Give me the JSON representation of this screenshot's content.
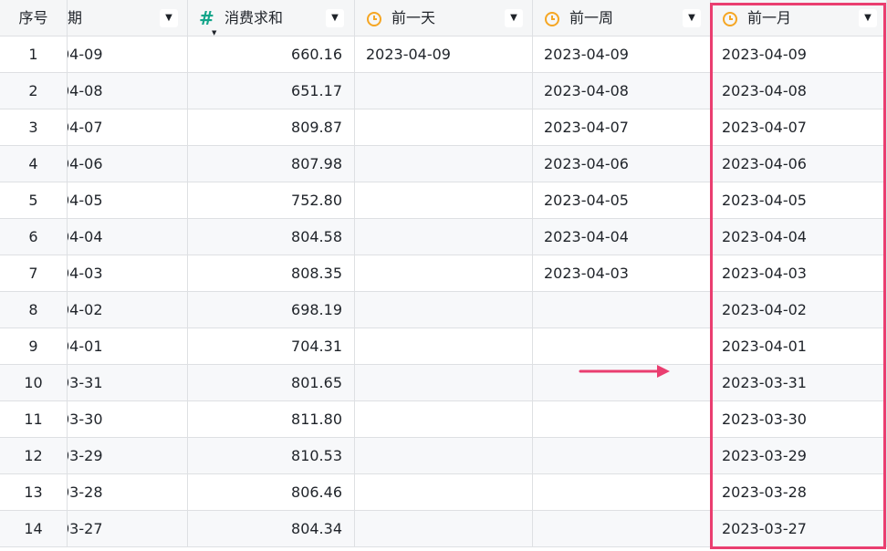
{
  "columns": {
    "index": {
      "label": "序号"
    },
    "date": {
      "label": "期"
    },
    "sum": {
      "label": "消费求和",
      "icon": "number-icon"
    },
    "prev_day": {
      "label": "前一天",
      "icon": "clock-icon"
    },
    "prev_week": {
      "label": "前一周",
      "icon": "clock-icon"
    },
    "prev_month": {
      "label": "前一月",
      "icon": "clock-icon"
    }
  },
  "rows": [
    {
      "idx": "1",
      "date": "04-09",
      "sum": "660.16",
      "prev_day": "2023-04-09",
      "prev_week": "2023-04-09",
      "prev_month": "2023-04-09"
    },
    {
      "idx": "2",
      "date": "04-08",
      "sum": "651.17",
      "prev_day": "",
      "prev_week": "2023-04-08",
      "prev_month": "2023-04-08"
    },
    {
      "idx": "3",
      "date": "04-07",
      "sum": "809.87",
      "prev_day": "",
      "prev_week": "2023-04-07",
      "prev_month": "2023-04-07"
    },
    {
      "idx": "4",
      "date": "04-06",
      "sum": "807.98",
      "prev_day": "",
      "prev_week": "2023-04-06",
      "prev_month": "2023-04-06"
    },
    {
      "idx": "5",
      "date": "04-05",
      "sum": "752.80",
      "prev_day": "",
      "prev_week": "2023-04-05",
      "prev_month": "2023-04-05"
    },
    {
      "idx": "6",
      "date": "04-04",
      "sum": "804.58",
      "prev_day": "",
      "prev_week": "2023-04-04",
      "prev_month": "2023-04-04"
    },
    {
      "idx": "7",
      "date": "04-03",
      "sum": "808.35",
      "prev_day": "",
      "prev_week": "2023-04-03",
      "prev_month": "2023-04-03"
    },
    {
      "idx": "8",
      "date": "04-02",
      "sum": "698.19",
      "prev_day": "",
      "prev_week": "",
      "prev_month": "2023-04-02"
    },
    {
      "idx": "9",
      "date": "04-01",
      "sum": "704.31",
      "prev_day": "",
      "prev_week": "",
      "prev_month": "2023-04-01"
    },
    {
      "idx": "10",
      "date": "03-31",
      "sum": "801.65",
      "prev_day": "",
      "prev_week": "",
      "prev_month": "2023-03-31"
    },
    {
      "idx": "11",
      "date": "03-30",
      "sum": "811.80",
      "prev_day": "",
      "prev_week": "",
      "prev_month": "2023-03-30"
    },
    {
      "idx": "12",
      "date": "03-29",
      "sum": "810.53",
      "prev_day": "",
      "prev_week": "",
      "prev_month": "2023-03-29"
    },
    {
      "idx": "13",
      "date": "03-28",
      "sum": "806.46",
      "prev_day": "",
      "prev_week": "",
      "prev_month": "2023-03-28"
    },
    {
      "idx": "14",
      "date": "03-27",
      "sum": "804.34",
      "prev_day": "",
      "prev_week": "",
      "prev_month": "2023-03-27"
    }
  ],
  "colors": {
    "accent_highlight": "#ea3e70",
    "clock_icon": "#f5a623",
    "number_icon": "#12a58a",
    "header_bg": "#f5f6f7",
    "grid_line": "#dee0e3"
  }
}
